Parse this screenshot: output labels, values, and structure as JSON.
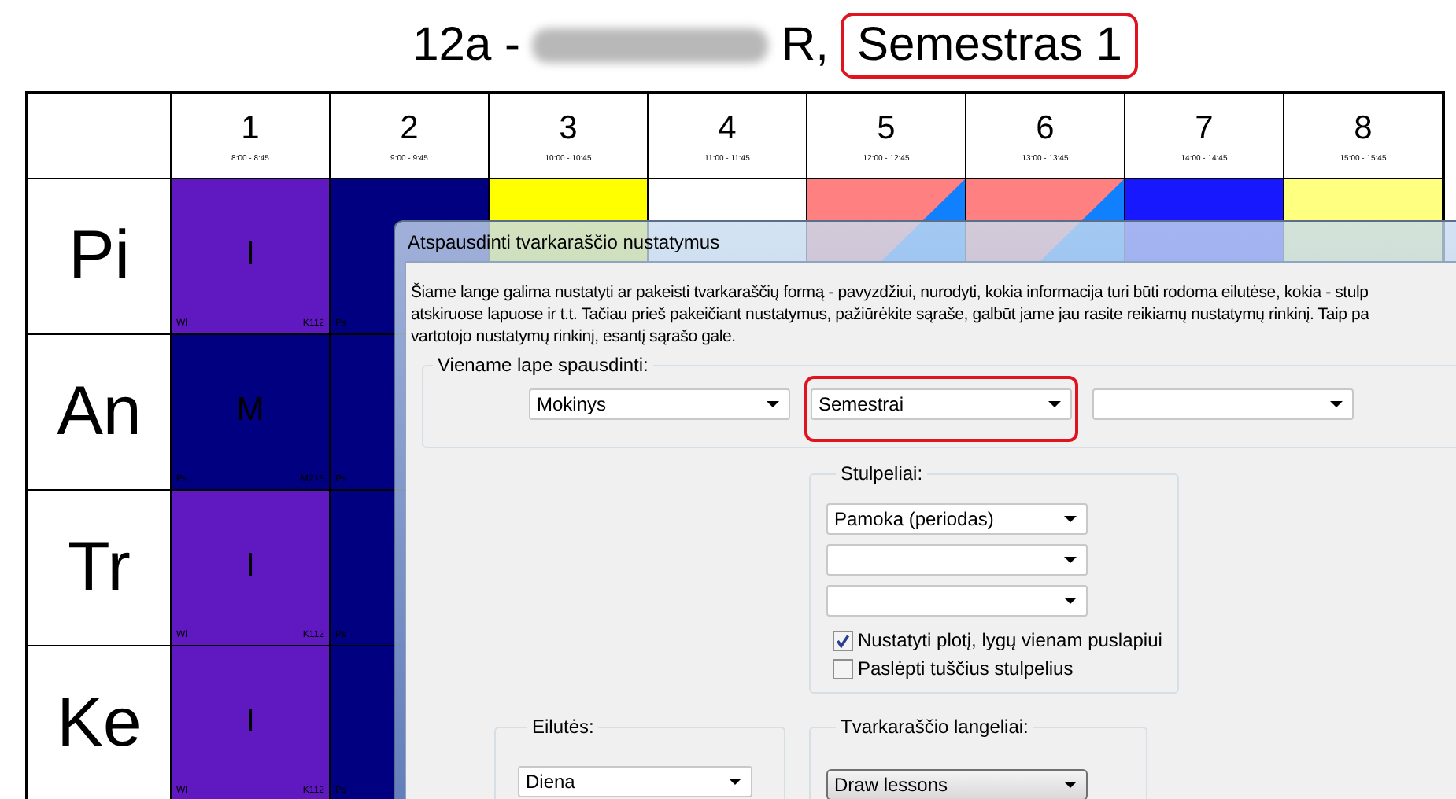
{
  "title": {
    "class_label": "12a -",
    "name_end": "R,",
    "term": "Semestras 1",
    "term_highlighted": true
  },
  "timetable": {
    "periods": [
      {
        "number": "1",
        "time": "8:00 - 8:45"
      },
      {
        "number": "2",
        "time": "9:00 - 9:45"
      },
      {
        "number": "3",
        "time": "10:00 - 10:45"
      },
      {
        "number": "4",
        "time": "11:00 - 11:45"
      },
      {
        "number": "5",
        "time": "12:00 - 12:45"
      },
      {
        "number": "6",
        "time": "13:00 - 13:45"
      },
      {
        "number": "7",
        "time": "14:00 - 14:45"
      },
      {
        "number": "8",
        "time": "15:00 - 15:45"
      }
    ],
    "rows": [
      {
        "label": "Pi",
        "cells": [
          {
            "color": "#6018c0",
            "subject": "I",
            "teacher": "Wl",
            "room": "K112"
          },
          {
            "color": "#000080",
            "teacher": "Ps"
          },
          {
            "color": "#ffff00"
          },
          {
            "color": "#ffffff"
          },
          {
            "color": "#ff8080",
            "corner": {
              "color": "#1080ff"
            }
          },
          {
            "color": "#ff8080",
            "corner": {
              "color": "#1080ff"
            }
          },
          {
            "color": "#1818ff"
          },
          {
            "color": "#ffff80"
          }
        ]
      },
      {
        "label": "An",
        "cells": [
          {
            "color": "#000080",
            "subject": "M",
            "teacher": "Ps",
            "room": "M218"
          },
          {
            "color": "#000080",
            "teacher": "Ps"
          }
        ]
      },
      {
        "label": "Tr",
        "cells": [
          {
            "color": "#6018c0",
            "subject": "I",
            "teacher": "Wl",
            "room": "K112"
          },
          {
            "color": "#000080",
            "teacher": "Ps"
          }
        ]
      },
      {
        "label": "Ke",
        "cells": [
          {
            "color": "#6018c0",
            "subject": "I",
            "teacher": "Wl",
            "room": "K112"
          },
          {
            "color": "#000080",
            "teacher": "Ps"
          }
        ]
      }
    ]
  },
  "dialog": {
    "title": "Atspausdinti tvarkaraščio nustatymus",
    "description_lines": [
      "Šiame lange galima nustatyti ar pakeisti tvarkaraščių formą - pavyzdžiui, nurodyti, kokia informacija turi būti rodoma eilutėse, kokia - stulp",
      "atskiruose lapuose ir t.t. Tačiau prieš pakeičiant nustatymus, pažiūrėkite sąraše, galbūt jame jau rasite reikiamų nustatymų rinkinį. Taip pa",
      "vartotojo nustatymų rinkinį, esantį sąrašo gale."
    ],
    "print_per_page": {
      "label": "Viename lape spausdinti:",
      "selects": [
        {
          "kind": "combo",
          "value": "Mokinys",
          "highlighted": false
        },
        {
          "kind": "combo",
          "value": "Semestrai",
          "highlighted": true
        },
        {
          "kind": "combo",
          "highlighted": false
        }
      ]
    },
    "columns_group": {
      "label": "Stulpeliai:",
      "selects": [
        {
          "kind": "combo",
          "value": "Pamoka (periodas)"
        },
        {
          "kind": "combo"
        },
        {
          "kind": "combo"
        }
      ],
      "checkboxes": [
        {
          "label": "Nustatyti plotį, lygų vienam puslapiui",
          "checked": true
        },
        {
          "label": "Paslėpti tuščius stulpelius",
          "checked": false
        }
      ]
    },
    "rows_group": {
      "label": "Eilutės:",
      "selects": [
        {
          "kind": "combo",
          "value": "Diena"
        }
      ]
    },
    "cells_group": {
      "label": "Tvarkaraščio langeliai:",
      "selects": [
        {
          "kind": "button",
          "value": "Draw lessons"
        }
      ]
    }
  }
}
